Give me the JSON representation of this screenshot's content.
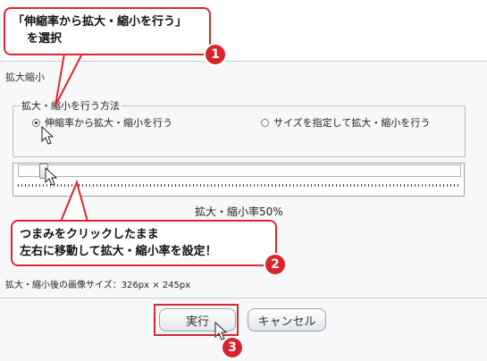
{
  "dialog": {
    "title": "拡大縮小",
    "group_legend": "拡大・縮小を行う方法",
    "radio_options": [
      {
        "label": "伸縮率から拡大・縮小を行う",
        "selected": true
      },
      {
        "label": "サイズを指定して拡大・縮小を行う",
        "selected": false
      }
    ],
    "slider": {
      "value_percent": 50
    },
    "ratio_label": "拡大・縮小率50%",
    "size_label": "拡大・縮小後の画像サイズ：326px × 245px",
    "buttons": {
      "execute": "実行",
      "cancel": "キャンセル"
    }
  },
  "annotations": {
    "callout1": {
      "line1": "「伸縮率から拡大・縮小を行う」",
      "line2": "を選択"
    },
    "callout2": {
      "line1": "つまみをクリックしたまま",
      "line2": "左右に移動して拡大・縮小率を設定！"
    },
    "badges": [
      "1",
      "2",
      "3"
    ]
  },
  "colors": {
    "accent": "#d8242a"
  }
}
